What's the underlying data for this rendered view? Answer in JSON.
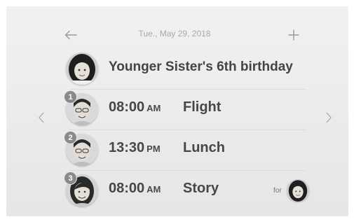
{
  "header": {
    "date": "Tue., May 29, 2018",
    "back_icon": "arrow-left-icon",
    "add_icon": "plus-icon"
  },
  "navigation": {
    "prev_icon": "chevron-left-icon",
    "next_icon": "chevron-right-icon"
  },
  "title_row": {
    "title": "Younger Sister's 6th birthday",
    "avatar": "girl-avatar"
  },
  "schedule": [
    {
      "index": "1",
      "time": "08:00",
      "period": "AM",
      "event": "Flight",
      "avatar": "man-avatar"
    },
    {
      "index": "2",
      "time": "13:30",
      "period": "PM",
      "event": "Lunch",
      "avatar": "man-avatar"
    },
    {
      "index": "3",
      "time": "08:00",
      "period": "AM",
      "event": "Story",
      "avatar": "woman-avatar",
      "for_label": "for",
      "for_avatar": "girl-avatar"
    }
  ],
  "colors": {
    "background": "#ececec",
    "text_primary": "#474747",
    "text_muted": "#a9a9a9",
    "badge": "#8a8a8a"
  }
}
